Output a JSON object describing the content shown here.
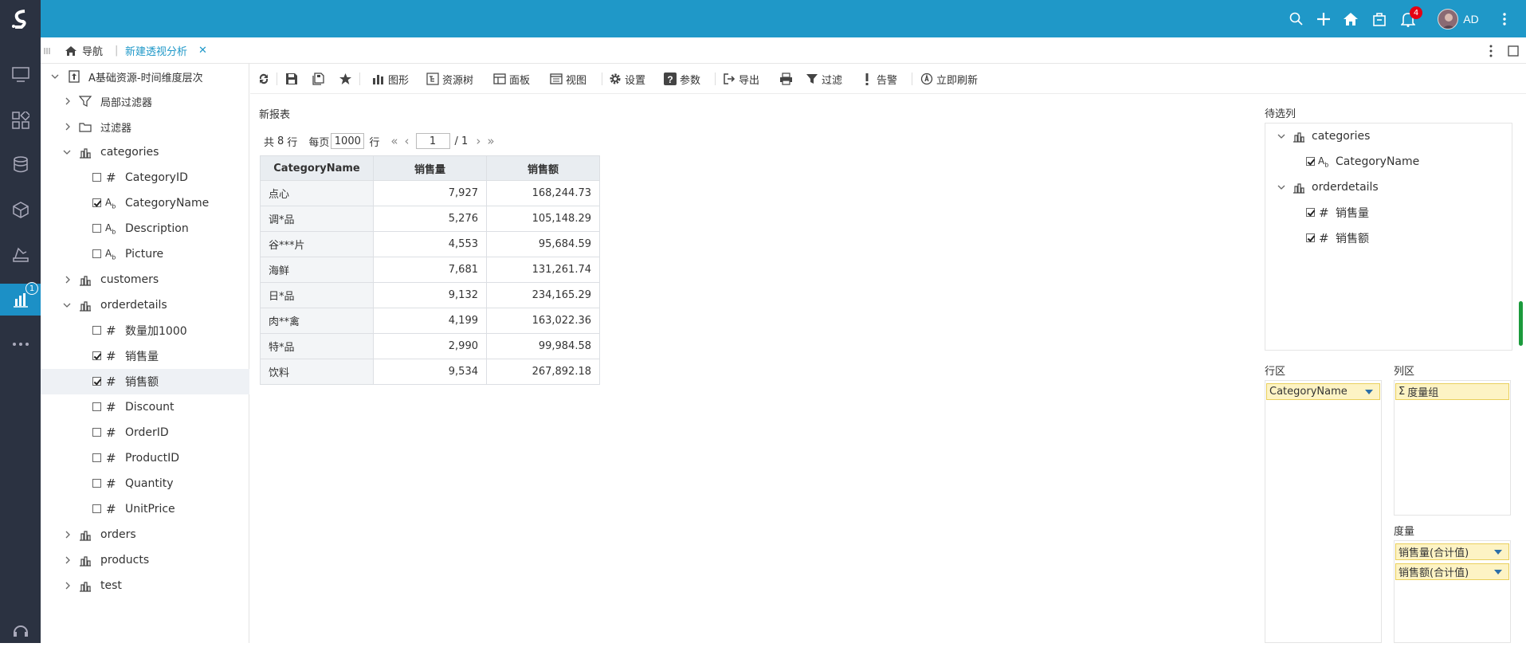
{
  "header": {
    "notifications_count": "4",
    "user_initials": "AD"
  },
  "rail": {
    "analysis_badge": "1"
  },
  "tabs": {
    "nav_label": "导航",
    "active_label": "新建透视分析"
  },
  "tree": {
    "root": "A基础资源-时间维度层次",
    "local_filter": "局部过滤器",
    "filter": "过滤器",
    "categories": "categories",
    "cat_fields": [
      "CategoryID",
      "CategoryName",
      "Description",
      "Picture"
    ],
    "customers": "customers",
    "orderdetails": "orderdetails",
    "od_fields": [
      "数量加1000",
      "销售量",
      "销售额",
      "Discount",
      "OrderID",
      "ProductID",
      "Quantity",
      "UnitPrice"
    ],
    "orders": "orders",
    "products": "products",
    "test": "test"
  },
  "toolbar": {
    "chart": "图形",
    "resource_tree": "资源树",
    "panel": "面板",
    "view": "视图",
    "settings": "设置",
    "params": "参数",
    "export": "导出",
    "filter": "过滤",
    "alert": "告警",
    "refresh_now": "立即刷新"
  },
  "report": {
    "title": "新报表",
    "total_prefix": "共",
    "total_rows": "8",
    "row_unit": "行",
    "per_page_label": "每页",
    "per_page": "1000",
    "per_page_unit": "行",
    "current_page": "1",
    "page_total": "/ 1",
    "columns": [
      "CategoryName",
      "销售量",
      "销售额"
    ],
    "rows": [
      [
        "点心",
        "7,927",
        "168,244.73"
      ],
      [
        "调*品",
        "5,276",
        "105,148.29"
      ],
      [
        "谷***片",
        "4,553",
        "95,684.59"
      ],
      [
        "海鲜",
        "7,681",
        "131,261.74"
      ],
      [
        "日*品",
        "9,132",
        "234,165.29"
      ],
      [
        "肉**禽",
        "4,199",
        "163,022.36"
      ],
      [
        "特*品",
        "2,990",
        "99,984.58"
      ],
      [
        "饮料",
        "9,534",
        "267,892.18"
      ]
    ]
  },
  "right": {
    "candidates_label": "待选列",
    "cand_categories": "categories",
    "cand_category_name": "CategoryName",
    "cand_orderdetails": "orderdetails",
    "cand_sales_qty": "销售量",
    "cand_sales_amt": "销售额",
    "row_zone_label": "行区",
    "col_zone_label": "列区",
    "row_pill": "CategoryName",
    "col_pill": "度量组",
    "measure_label": "度量",
    "measure_pill_1": "销售量(合计值)",
    "measure_pill_2": "销售额(合计值)"
  }
}
